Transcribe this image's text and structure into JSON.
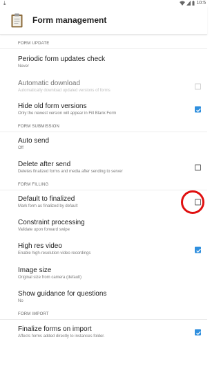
{
  "status_bar": {
    "time": "10:5"
  },
  "app_bar": {
    "title": "Form management"
  },
  "sections": [
    {
      "header": "FORM UPDATE",
      "items": [
        {
          "title": "Periodic form updates check",
          "summary": "Never",
          "control": "none",
          "disabled": false
        },
        {
          "title": "Automatic download",
          "summary": "Automatically download updated versions of forms",
          "control": "checkbox",
          "checked": false,
          "disabled": true
        },
        {
          "title": "Hide old form versions",
          "summary": "Only the newest version will appear in Fill Blank Form",
          "control": "checkbox",
          "checked": true,
          "disabled": false
        }
      ]
    },
    {
      "header": "FORM SUBMISSION",
      "items": [
        {
          "title": "Auto send",
          "summary": "Off",
          "control": "none",
          "disabled": false
        },
        {
          "title": "Delete after send",
          "summary": "Deletes finalized forms and media after sending to server",
          "control": "checkbox",
          "checked": false,
          "disabled": false
        }
      ]
    },
    {
      "header": "FORM FILLING",
      "items": [
        {
          "title": "Default to finalized",
          "summary": "Mark form as finalized by default",
          "control": "checkbox",
          "checked": false,
          "disabled": false,
          "highlighted": true
        },
        {
          "title": "Constraint processing",
          "summary": "Validate upon forward swipe",
          "control": "none",
          "disabled": false
        },
        {
          "title": "High res video",
          "summary": "Enable high-resolution video recordings",
          "control": "checkbox",
          "checked": true,
          "disabled": false
        },
        {
          "title": "Image size",
          "summary": "Original size from camera (default)",
          "control": "none",
          "disabled": false
        },
        {
          "title": "Show guidance for questions",
          "summary": "No",
          "control": "none",
          "disabled": false
        }
      ]
    },
    {
      "header": "FORM IMPORT",
      "items": [
        {
          "title": "Finalize forms on import",
          "summary": "Affects forms added directly to instances folder.",
          "control": "checkbox",
          "checked": true,
          "disabled": false
        }
      ]
    }
  ],
  "colors": {
    "accent": "#2f8fde",
    "highlight_ring": "#e01010"
  }
}
